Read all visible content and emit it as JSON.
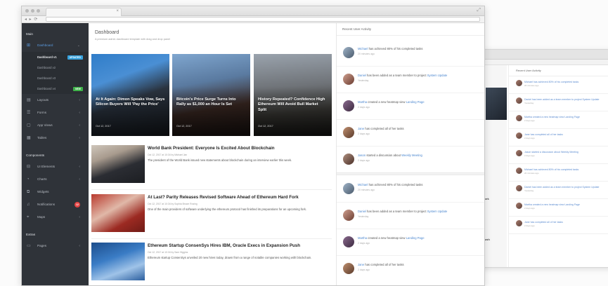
{
  "sidebar": {
    "section_main": "Main",
    "section_components": "Components",
    "section_extras": "Extras",
    "items_main": [
      {
        "label": "Dashboard",
        "icon": "dashboard-icon"
      },
      {
        "label": "Layouts",
        "icon": "layout-icon"
      },
      {
        "label": "Forms",
        "icon": "form-icon"
      },
      {
        "label": "App Views",
        "icon": "window-icon"
      },
      {
        "label": "Tables",
        "icon": "table-icon"
      }
    ],
    "dashboard_sub": [
      {
        "label": "Dashboard v1",
        "badge": "UPDATED"
      },
      {
        "label": "Dashboard v2",
        "badge": ""
      },
      {
        "label": "Dashboard v3",
        "badge": ""
      },
      {
        "label": "Dashboard v4",
        "badge": "NEW"
      }
    ],
    "items_components": [
      {
        "label": "UI Elements",
        "icon": "grid-icon"
      },
      {
        "label": "Charts",
        "icon": "chart-icon"
      },
      {
        "label": "Widgets",
        "icon": "widget-icon"
      },
      {
        "label": "Notifications",
        "icon": "bell-icon",
        "count": "12"
      },
      {
        "label": "Maps",
        "icon": "map-icon"
      }
    ],
    "items_extras": [
      {
        "label": "Pages",
        "icon": "pages-icon"
      }
    ]
  },
  "main": {
    "title": "Dashboard",
    "subtitle": "A premium admin dashboard template with drag and drop panel",
    "featured": [
      {
        "title": "At It Again: Dimon Speaks Vow, Says Silicon Buyers Will 'Pay the Price'",
        "date": "Oct 12, 2017"
      },
      {
        "title": "Bitcoin's Price Surge Turns Into Rally as $1,000 an Hour Is Set",
        "date": "Oct 12, 2017"
      },
      {
        "title": "History Repeated? Confidence High Ethereum Will Avoid Bull Market Split",
        "date": "Oct 12, 2017"
      }
    ],
    "articles": [
      {
        "title": "World Bank President: Everyone Is Excited About Blockchain",
        "meta": "Oct 12, 2017 at 10:34 by Michael Jan",
        "body": "The president of the World Bank issued new statements about blockchain during an interview earlier this week."
      },
      {
        "title": "At Last? Parity Releases Revised Software Ahead of Ethereum Hard Fork",
        "meta": "Oct 12, 2017 at 10:34 by Sophia Brown Rosing",
        "body": "One of the main providers of software underlying the ethereum protocol has finished its preparations for an upcoming fork."
      },
      {
        "title": "Ethereum Startup ConsenSys Hires IBM, Oracle Execs in Expansion Push",
        "meta": "Oct 12, 2017 at 10:34 by Sam Higgins",
        "body": "Ethereum startup ConsenSys unveiled 20 new hires today, drawn from a range of notable companies working with blockchain."
      }
    ]
  },
  "activity": {
    "title": "Recent User Activity",
    "items": [
      {
        "name": "Michael",
        "text": " has achieved 80% of his completed tasks",
        "link": "",
        "time": "20 minutes ago"
      },
      {
        "name": "Daniel",
        "text": " has been added as a team member to project ",
        "link": "System Update",
        "time": "Yesterday"
      },
      {
        "name": "Martha",
        "text": " created a new heatmap view ",
        "link": "Landing Page",
        "time": "2 days ago"
      },
      {
        "name": "Jane",
        "text": " has completed all of her tasks",
        "link": "",
        "time": "2 days ago"
      },
      {
        "name": "Jason",
        "text": " started a discussion about ",
        "link": "Weekly Meeting",
        "time": "2 days ago"
      },
      {
        "name": "Michael",
        "text": " has achieved 80% of his completed tasks",
        "link": "",
        "time": "20 minutes ago"
      },
      {
        "name": "Daniel",
        "text": " has been added as a team member to project ",
        "link": "System Update",
        "time": "Yesterday"
      },
      {
        "name": "Martha",
        "text": " created a new heatmap view ",
        "link": "Landing Page",
        "time": "2 days ago"
      },
      {
        "name": "Jane",
        "text": " has completed all of her tasks",
        "link": "",
        "time": "2 days ago"
      }
    ]
  },
  "back_window": {
    "activity_title": "Recent User Activity",
    "items": [
      {
        "name": "Michael",
        "text": " has achieved 80% of his completed tasks",
        "time": "20 minutes ago"
      },
      {
        "name": "Daniel",
        "text": " has been added as a team member to project System Update",
        "time": "Yesterday"
      },
      {
        "name": "Martha",
        "text": " created a new heatmap view Landing Page",
        "time": "2 days ago"
      },
      {
        "name": "Jane",
        "text": " has completed all of her tasks",
        "time": "2 days ago"
      },
      {
        "name": "Jason",
        "text": " started a discussion about Weekly Meeting",
        "time": "2 days ago"
      },
      {
        "name": "Michael",
        "text": " has achieved 80% of his completed tasks",
        "time": "20 minutes ago"
      },
      {
        "name": "Daniel",
        "text": " has been added as a team member to project System Update",
        "time": "Yesterday"
      },
      {
        "name": "Martha",
        "text": " created a new heatmap view Landing Page",
        "time": "2 days ago"
      },
      {
        "name": "Jane",
        "text": " has completed all of her tasks",
        "time": "2 days ago"
      }
    ],
    "snippets": [
      "Fork",
      "Push"
    ]
  },
  "colors": {
    "sidebar_bg": "#2f3339",
    "accent": "#4a86cf",
    "badge_updated": "#38a3de",
    "badge_new": "#3fb34a",
    "badge_alert": "#e54545"
  }
}
